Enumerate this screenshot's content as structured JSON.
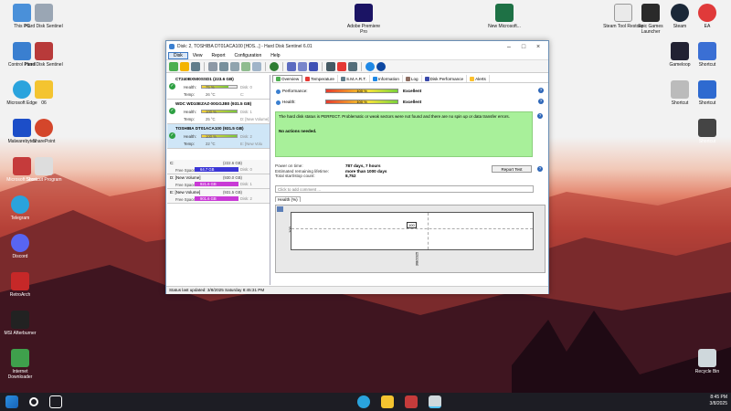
{
  "desktop_icons": [
    {
      "label": "This PC",
      "color": "#4a90d9"
    },
    {
      "label": "Hard Disk Sentinel",
      "color": "#9aa6b4"
    },
    {
      "label": "Control Panel",
      "color": "#3a7fd0"
    },
    {
      "label": "Hard Disk Sentinel",
      "color": "#b83a3a"
    },
    {
      "label": "Microsoft Edge",
      "color": "#2aa3dd"
    },
    {
      "label": "06",
      "color": "#f4c430"
    },
    {
      "label": "Malwarebytes",
      "color": "#1c4ec8"
    },
    {
      "label": "SharePoint",
      "color": "#d4462b"
    },
    {
      "label": "Microsoft Store",
      "color": "#c53b3b"
    },
    {
      "label": "Shortcut Program",
      "color": "#ddd"
    },
    {
      "label": "Telegram",
      "color": "#2aa3dd"
    },
    {
      "label": "Discord",
      "color": "#5865f2"
    },
    {
      "label": "RetroArch",
      "color": "#c62828"
    },
    {
      "label": "MSI Afterburner",
      "color": "#222"
    },
    {
      "label": "Internet Downloader",
      "color": "#3fa04c"
    }
  ],
  "top_icons": [
    {
      "label": "Adobe Premiere Pro",
      "color": "#1b1464"
    },
    {
      "label": "New Microsoft...",
      "color": "#1e7145"
    },
    {
      "label": "Steam Tool Restore",
      "color": "#eaeaea"
    },
    {
      "label": "Epic Games Launcher",
      "color": "#2a2a2a"
    },
    {
      "label": "Steam",
      "color": "#1b2838"
    },
    {
      "label": "EA",
      "color": "#e03a3a"
    },
    {
      "label": "Gameloop",
      "color": "#223"
    },
    {
      "label": "Shortcut",
      "color": "#3a6fd4"
    },
    {
      "label": "Shortcut",
      "color": "#bbb"
    },
    {
      "label": "Shortcut",
      "color": "#2e6ad0"
    },
    {
      "label": "Shortcut",
      "color": "#444"
    },
    {
      "label": "Recycle Bin",
      "color": "#cfd8dc"
    }
  ],
  "window": {
    "title": "Disk: 2, TOSHIBA DT01ACA100 [HDS...] - Hard Disk Sentinel 6.01",
    "menu": [
      "Disk",
      "View",
      "Report",
      "Configuration",
      "Help"
    ],
    "disks": [
      {
        "name": "CT240BX500SSD1 (223.6 GB)",
        "health": "75 %",
        "health_pct": 75,
        "temp": "26 °C",
        "drive": "Disk: 0",
        "temp_drive": "C:"
      },
      {
        "name": "WDC WD10EZAZ-00GGJB0 (931.5 GB)",
        "health": "100 %",
        "health_pct": 100,
        "temp": "25 °C",
        "drive": "Disk: 1",
        "temp_drive": "D: [New Volume]"
      },
      {
        "name": "TOSHIBA DT01ACA100 (931.5 GB)",
        "health": "100 %",
        "health_pct": 100,
        "temp": "22 °C",
        "drive": "Disk: 2",
        "temp_drive": "E: [New Volu"
      }
    ],
    "health_label": "Health:",
    "temp_label": "Temp:",
    "volumes": [
      {
        "name": "C:",
        "size": "(222.6 GB)",
        "free": "64.7 GB",
        "disk": "Disk: 0",
        "color": "#3b36d6"
      },
      {
        "name": "D: [New Volume]",
        "size": "(930.0 GB)",
        "free": "921.6 GB",
        "disk": "Disk: 1",
        "color": "#c93ad6"
      },
      {
        "name": "E: [New Volume]",
        "size": "(931.5 GB)",
        "free": "901.6 GB",
        "disk": "Disk: 2",
        "color": "#c93ad6"
      }
    ],
    "free_space_label": "Free Space",
    "tabs": [
      "Overview",
      "Temperature",
      "S.M.A.R.T.",
      "Information",
      "Log",
      "Disk Performance",
      "Alerts"
    ],
    "performance": {
      "label": "Performance:",
      "value": "100 %",
      "status": "Excellent"
    },
    "health": {
      "label": "Health:",
      "value": "100 %",
      "status": "Excellent"
    },
    "status_text": "The hard disk status is PERFECT. Problematic or weak sectors were not found and there are no spin up or data transfer errors.",
    "actions_text": "No actions needed.",
    "power_on_label": "Power on time:",
    "power_on_value": "787 days, 7 hours",
    "lifetime_label": "Estimated remaining lifetime:",
    "lifetime_value": "more than 1000 days",
    "startstop_label": "Total start/stop count:",
    "startstop_value": "8,752",
    "report_button": "Report Test",
    "comment_placeholder": "Click to add comment ...",
    "health_tab": "Health (%)",
    "graph_ylabel": "100",
    "graph_point": "100",
    "graph_xlabel": "3/8/2025",
    "statusbar": "Status last updated: 3/8/2025 Saturday 8:45:31 PM"
  },
  "tray": {
    "time": "8:45 PM",
    "date": "3/8/2025"
  }
}
